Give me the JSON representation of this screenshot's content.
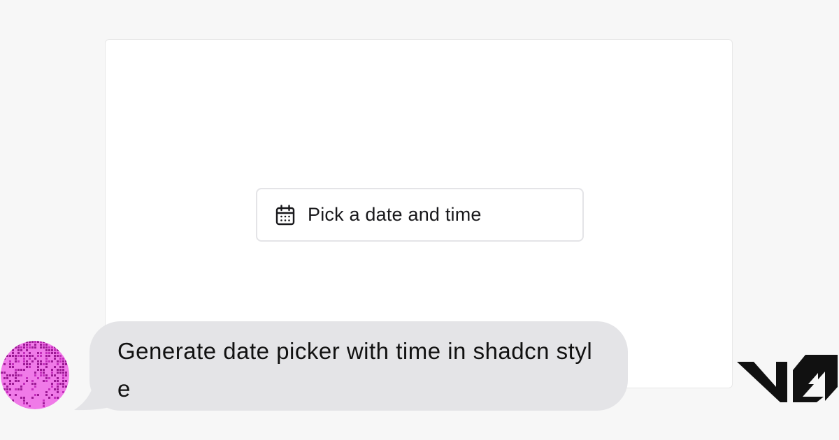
{
  "preview": {
    "date_button_label": "Pick a date and time",
    "icon": "calendar-icon"
  },
  "chat": {
    "prompt": "Generate date picker with time in shadcn style",
    "avatar_icon": "user-avatar"
  },
  "brand": {
    "logo": "v0-logo",
    "accent": "#c21fbf"
  }
}
